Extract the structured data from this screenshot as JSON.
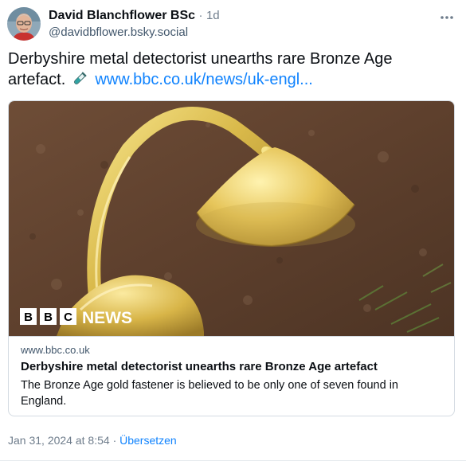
{
  "author": {
    "display_name": "David Blanchflower BSc",
    "separator": "·",
    "age": "1d",
    "handle": "@davidbflower.bsky.social"
  },
  "post": {
    "text": "Derbyshire metal detectorist unearths rare Bronze Age artefact.",
    "emoji_icon": "test-tube-icon",
    "link_text": "www.bbc.co.uk/news/uk-engl..."
  },
  "card": {
    "image_overlay_logo": "BBC NEWS",
    "domain": "www.bbc.co.uk",
    "title": "Derbyshire metal detectorist unearths rare Bronze Age artefact",
    "description": "The Bronze Age gold fastener is believed to be only one of seven found in England."
  },
  "footer": {
    "timestamp": "Jan 31, 2024 at 8:54",
    "separator": "·",
    "translate_label": "Übersetzen"
  },
  "colors": {
    "link": "#1083fe",
    "muted": "#6f7d8c",
    "border": "#d4dbe2"
  }
}
